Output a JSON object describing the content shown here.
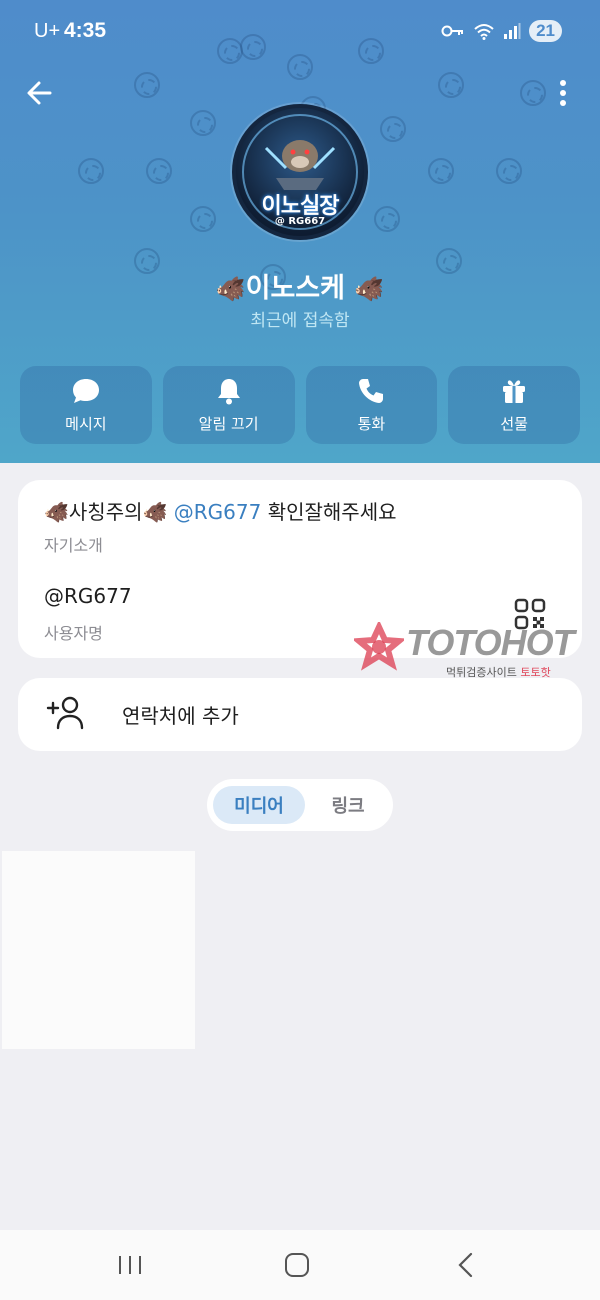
{
  "status_bar": {
    "carrier": "U+",
    "time": "4:35",
    "battery": "21",
    "icons": [
      "key-icon",
      "wifi-icon",
      "signal-icon",
      "battery-icon"
    ]
  },
  "profile": {
    "avatar_text": "이노실장",
    "avatar_subtext": "@ RG667",
    "name": "이노스케",
    "name_prefix_emoji": "🐗",
    "name_suffix_emoji": "🐗",
    "last_seen": "최근에 접속함"
  },
  "actions": [
    {
      "label": "메시지",
      "icon": "message-icon"
    },
    {
      "label": "알림 끄기",
      "icon": "bell-icon"
    },
    {
      "label": "통화",
      "icon": "phone-icon"
    },
    {
      "label": "선물",
      "icon": "gift-icon"
    }
  ],
  "info": {
    "bio_prefix": "🐗사칭주의🐗 ",
    "bio_mention": "@RG677",
    "bio_suffix": " 확인잘해주세요",
    "bio_label": "자기소개",
    "username": "@RG677",
    "username_label": "사용자명"
  },
  "watermark": {
    "brand": "TOTOHOT",
    "sub_prefix": "먹튀검증사이트 ",
    "sub_highlight": "토토핫"
  },
  "add_contact": {
    "label": "연락처에 추가"
  },
  "tabs": {
    "media": "미디어",
    "links": "링크"
  },
  "colors": {
    "header_blue": "#4f8ccb",
    "accent": "#3a7fc0",
    "tab_active_bg": "#dbe9f7",
    "background": "#efeff3"
  }
}
